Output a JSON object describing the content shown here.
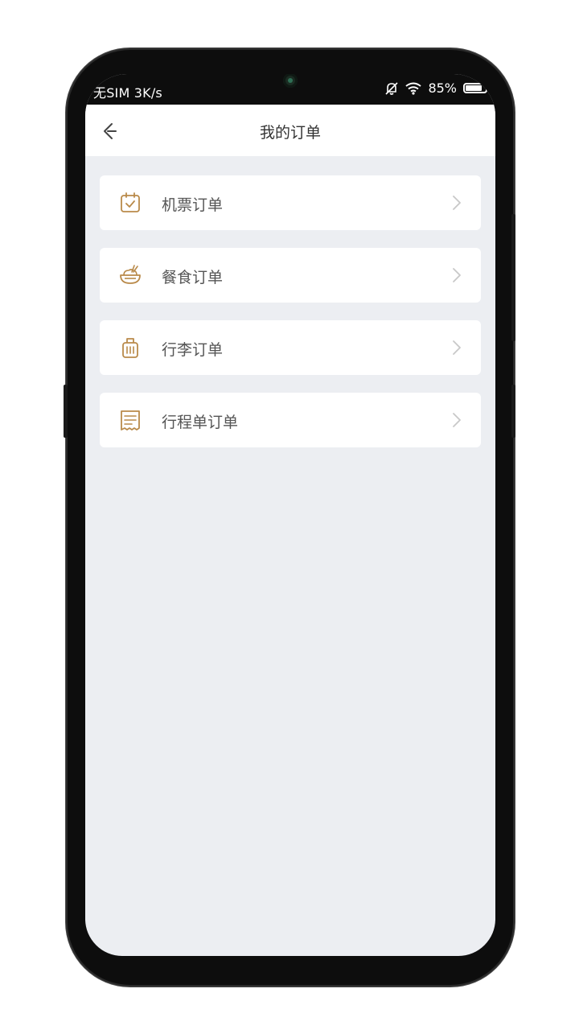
{
  "status_bar": {
    "carrier_speed": "无SIM 3K/s",
    "battery_text": "85%",
    "battery_level": 0.85,
    "icons": [
      "mute-bell-icon",
      "wifi-icon",
      "battery-icon"
    ]
  },
  "header": {
    "title": "我的订单",
    "back_icon": "back-arrow-icon"
  },
  "orders": [
    {
      "label": "机票订单",
      "icon": "calendar-check-icon"
    },
    {
      "label": "餐食订单",
      "icon": "meal-bowl-icon"
    },
    {
      "label": "行李订单",
      "icon": "luggage-icon"
    },
    {
      "label": "行程单订单",
      "icon": "receipt-icon"
    }
  ],
  "colors": {
    "accent": "#b98a4a",
    "background": "#eceef2",
    "card": "#ffffff",
    "text": "#555555",
    "chevron": "#c8c8c8"
  }
}
